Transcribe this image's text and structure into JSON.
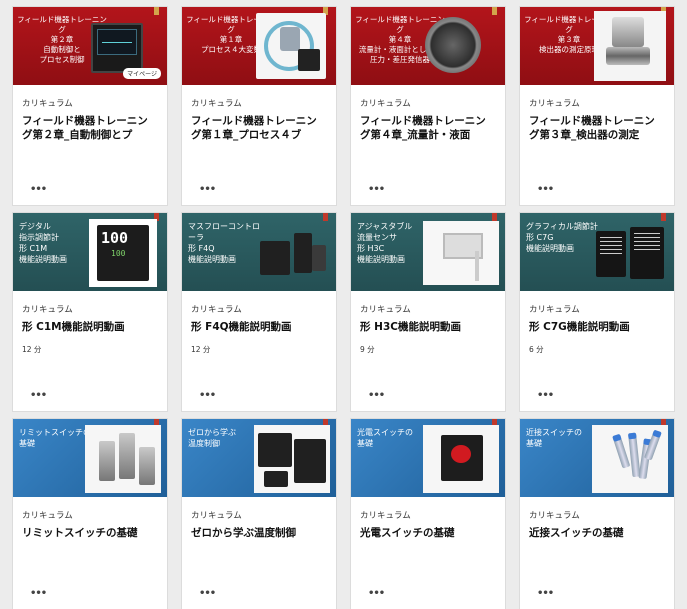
{
  "cards": [
    {
      "thumb_title": "フィールド機器トレーニング\n第２章\n自動制御と\nプロセス制御",
      "thumb_badge": "マイページ",
      "category": "カリキュラム",
      "title": "フィールド機器トレーニング第２章_自動制御とプ",
      "duration": "",
      "more": "•••"
    },
    {
      "thumb_title": "フィールド機器トレーニング\n第１章\nプロセス４大変数",
      "thumb_badge": "",
      "category": "カリキュラム",
      "title": "フィールド機器トレーニング第１章_プロセス４ブ",
      "duration": "",
      "more": "•••"
    },
    {
      "thumb_title": "フィールド機器トレーニング\n第４章\n流量計・液面計としての\n圧力・差圧発信器",
      "thumb_badge": "",
      "category": "カリキュラム",
      "title": "フィールド機器トレーニング第４章_流量計・液面",
      "duration": "",
      "more": "•••"
    },
    {
      "thumb_title": "フィールド機器トレーニング\n第３章\n検出器の測定原理",
      "thumb_badge": "",
      "category": "カリキュラム",
      "title": "フィールド機器トレーニング第３章_検出器の測定",
      "duration": "",
      "more": "•••"
    },
    {
      "thumb_title": "デジタル\n指示調節計\n形 C1M\n機能説明動画",
      "thumb_badge": "",
      "category": "カリキュラム",
      "title": "形 C1M機能説明動画",
      "duration": "12 分",
      "more": "•••"
    },
    {
      "thumb_title": "マスフローコントローラ\n形 F4Q\n機能説明動画",
      "thumb_badge": "",
      "category": "カリキュラム",
      "title": "形 F4Q機能説明動画",
      "duration": "12 分",
      "more": "•••"
    },
    {
      "thumb_title": "アジャスタブル\n流量センサ\n形 H3C\n機能説明動画",
      "thumb_badge": "",
      "category": "カリキュラム",
      "title": "形 H3C機能説明動画",
      "duration": "9 分",
      "more": "•••"
    },
    {
      "thumb_title": "グラフィカル調節計\n形 C7G\n機能説明動画",
      "thumb_badge": "",
      "category": "カリキュラム",
      "title": "形 C7G機能説明動画",
      "duration": "6 分",
      "more": "•••"
    },
    {
      "thumb_title": "リミットスイッチの\n基礎",
      "thumb_badge": "",
      "category": "カリキュラム",
      "title": "リミットスイッチの基礎",
      "duration": "",
      "more": "•••"
    },
    {
      "thumb_title": "ゼロから学ぶ\n温度制御",
      "thumb_badge": "",
      "category": "カリキュラム",
      "title": "ゼロから学ぶ温度制御",
      "duration": "",
      "more": "•••"
    },
    {
      "thumb_title": "光電スイッチの\n基礎",
      "thumb_badge": "",
      "category": "カリキュラム",
      "title": "光電スイッチの基礎",
      "duration": "",
      "more": "•••"
    },
    {
      "thumb_title": "近接スイッチの\n基礎",
      "thumb_badge": "",
      "category": "カリキュラム",
      "title": "近接スイッチの基礎",
      "duration": "",
      "more": "•••"
    }
  ],
  "display": {
    "c1m_main": "100",
    "c1m_sub": "100"
  },
  "colors": {
    "red": "#a31217",
    "teal": "#2b5c60",
    "blue": "#2e78bb",
    "flag": "#c0392b"
  }
}
